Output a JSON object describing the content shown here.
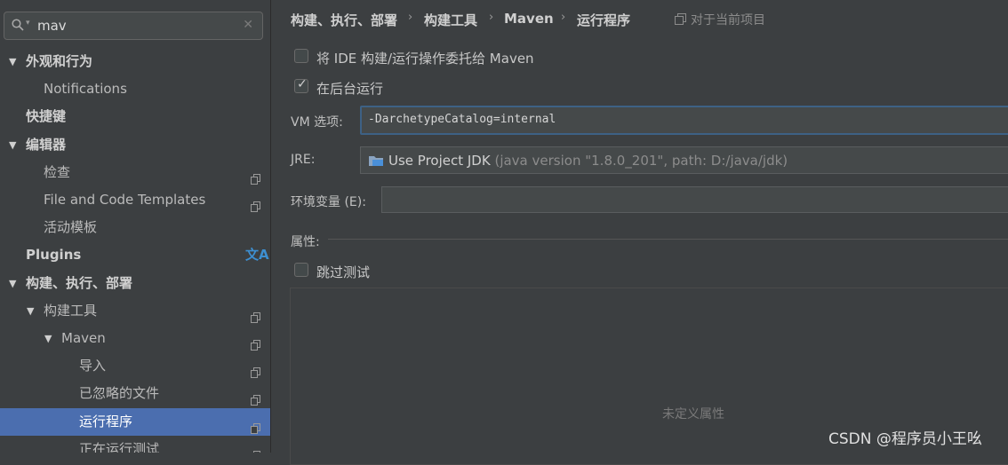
{
  "search": {
    "value": "mav",
    "icon": "search-icon"
  },
  "tree": [
    {
      "id": "appearance",
      "label": "外观和行为",
      "indent": 0,
      "expanded": true,
      "bold": true,
      "copy": false
    },
    {
      "id": "notifications",
      "label": "Notifications",
      "indent": 1,
      "expanded": null,
      "bold": false,
      "copy": false
    },
    {
      "id": "keymap",
      "label": "快捷键",
      "indent": 0,
      "expanded": null,
      "bold": true,
      "copy": false
    },
    {
      "id": "editor",
      "label": "编辑器",
      "indent": 0,
      "expanded": true,
      "bold": true,
      "copy": false
    },
    {
      "id": "inspections",
      "label": "检查",
      "indent": 1,
      "expanded": null,
      "bold": false,
      "copy": true
    },
    {
      "id": "file-templates",
      "label": "File and Code Templates",
      "indent": 1,
      "expanded": null,
      "bold": false,
      "copy": true
    },
    {
      "id": "live-templates",
      "label": "活动模板",
      "indent": 1,
      "expanded": null,
      "bold": false,
      "copy": false
    },
    {
      "id": "plugins",
      "label": "Plugins",
      "indent": 0,
      "expanded": null,
      "bold": true,
      "copy": false,
      "translate": true
    },
    {
      "id": "build",
      "label": "构建、执行、部署",
      "indent": 0,
      "expanded": true,
      "bold": true,
      "copy": false
    },
    {
      "id": "build-tools",
      "label": "构建工具",
      "indent": 1,
      "expanded": true,
      "bold": false,
      "copy": true
    },
    {
      "id": "maven",
      "label": "Maven",
      "indent": 2,
      "expanded": true,
      "bold": false,
      "copy": true
    },
    {
      "id": "importing",
      "label": "导入",
      "indent": 3,
      "expanded": null,
      "bold": false,
      "copy": true
    },
    {
      "id": "ignored-files",
      "label": "已忽略的文件",
      "indent": 3,
      "expanded": null,
      "bold": false,
      "copy": true
    },
    {
      "id": "runner",
      "label": "运行程序",
      "indent": 3,
      "expanded": null,
      "bold": false,
      "copy": true,
      "selected": true
    },
    {
      "id": "running-tests",
      "label": "正在运行测试",
      "indent": 3,
      "expanded": null,
      "bold": false,
      "copy": true
    }
  ],
  "tree_translate_glyph": "文A",
  "breadcrumb": {
    "items": [
      "构建、执行、部署",
      "构建工具",
      "Maven",
      "运行程序"
    ],
    "separator": "›",
    "project_scope": "对于当前项目"
  },
  "options": {
    "delegate": {
      "label": "将 IDE 构建/运行操作委托给 Maven",
      "checked": false
    },
    "background": {
      "label": "在后台运行",
      "checked": true
    },
    "skip_tests": {
      "label": "跳过测试",
      "checked": false
    }
  },
  "fields": {
    "vm": {
      "label": "VM 选项:",
      "value": "-DarchetypeCatalog=internal"
    },
    "jre": {
      "label": "JRE:",
      "value": "Use Project JDK",
      "detail": " (java version \"1.8.0_201\", path: D:/java/jdk)"
    },
    "env": {
      "label": "环境变量 (E):",
      "value": ""
    }
  },
  "properties": {
    "label": "属性:",
    "empty_text": "未定义属性"
  },
  "watermark": "CSDN @程序员小王吆",
  "colors": {
    "selection": "#4b6eaf",
    "focus_border": "#3d6185",
    "translate_icon": "#3d8fd1"
  }
}
